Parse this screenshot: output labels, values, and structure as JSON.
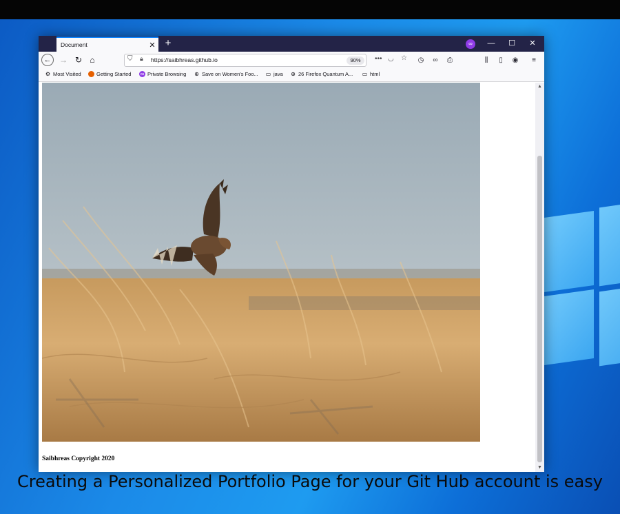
{
  "browser": {
    "tab_title": "Document",
    "tab_close": "✕",
    "new_tab": "+",
    "window_controls": {
      "minimize": "—",
      "maximize": "☐",
      "close": "✕"
    },
    "url": "https://saibhreas.github.io",
    "zoom": "90%",
    "page_actions": "•••",
    "bookmarks": [
      {
        "label": "Most Visited",
        "icon": "gear-icon"
      },
      {
        "label": "Getting Started",
        "icon": "firefox-icon"
      },
      {
        "label": "Private Browsing",
        "icon": "private-browsing-icon"
      },
      {
        "label": "Save on Women's Foo...",
        "icon": "globe-icon"
      },
      {
        "label": "java",
        "icon": "folder-icon"
      },
      {
        "label": "26 Firefox Quantum A...",
        "icon": "globe-icon"
      },
      {
        "label": "html",
        "icon": "folder-icon"
      }
    ]
  },
  "page": {
    "photo_subject": "hawk in flight over golden grass field",
    "copyright": "Saibhreas Copyright 2020"
  },
  "caption": "Creating a Personalized Portfolio Page for your Git Hub account is easy",
  "colors": {
    "tab_bar": "#232347",
    "accent": "#0a84ff",
    "private_badge": "#8f3ce6",
    "desktop_blue": "#1b8ae8"
  }
}
